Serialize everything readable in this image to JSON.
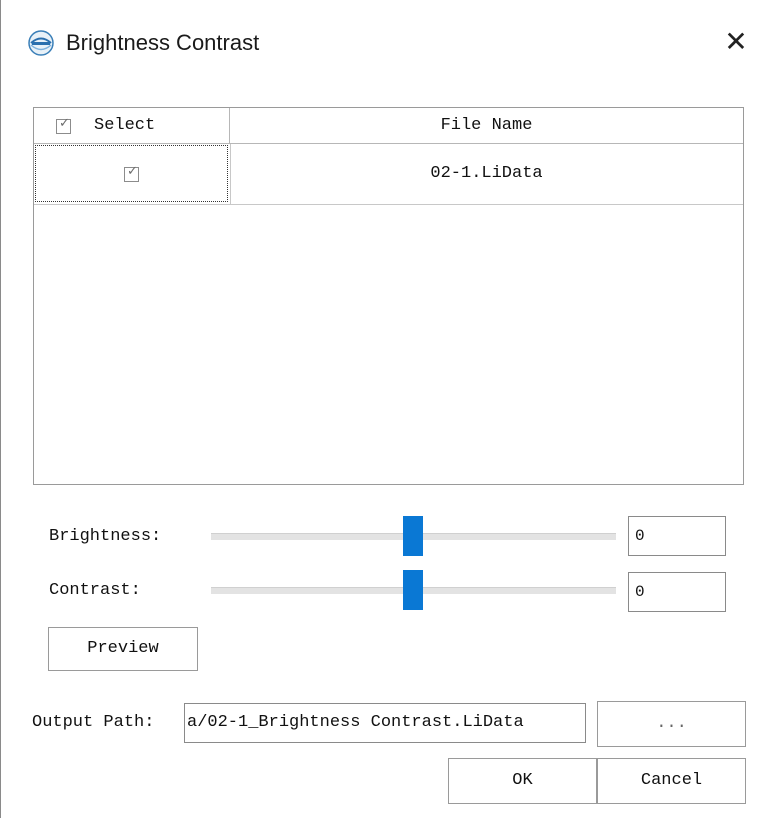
{
  "window": {
    "title": "Brightness Contrast",
    "close_glyph": "✕",
    "app_icon": "lidar-logo-icon"
  },
  "table": {
    "headers": {
      "select": "Select",
      "file_name": "File Name"
    },
    "header_select_checked": true,
    "rows": [
      {
        "checked": true,
        "file_name": "02-1.LiData"
      }
    ]
  },
  "params": {
    "brightness": {
      "label": "Brightness:",
      "value": "0",
      "slider_level": 0.5
    },
    "contrast": {
      "label": "Contrast:",
      "value": "0",
      "slider_level": 0.5
    }
  },
  "buttons": {
    "preview": "Preview",
    "browse": "...",
    "ok": "OK",
    "cancel": "Cancel"
  },
  "output": {
    "label": "Output Path:",
    "value": "a/02-1_Brightness Contrast.LiData"
  },
  "colors": {
    "accent": "#0a78d4",
    "border": "#9a9a9a"
  }
}
